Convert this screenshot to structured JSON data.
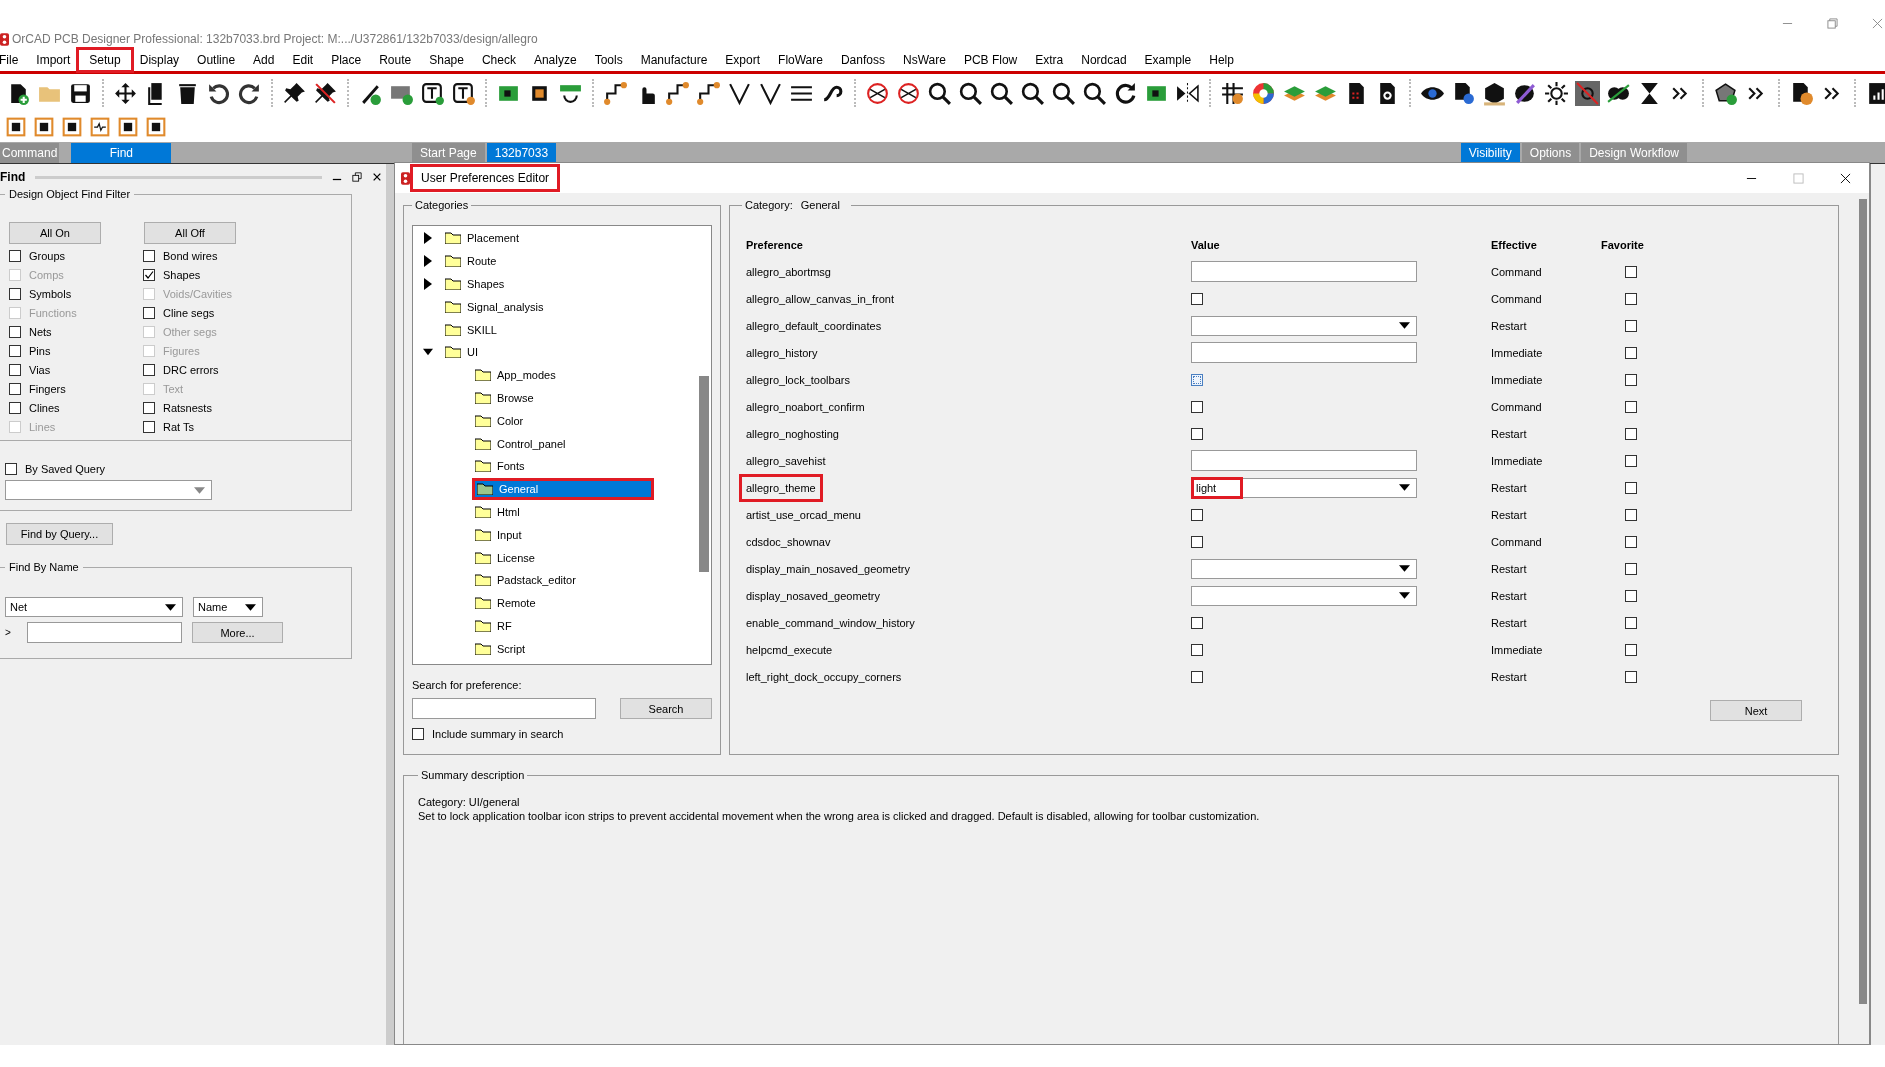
{
  "window": {
    "title": "OrCAD PCB Designer Professional: 132b7033.brd  Project: M:.../U372861/132b7033/design/allegro"
  },
  "menu": [
    {
      "label": "File",
      "highlighted": false
    },
    {
      "label": "Import",
      "highlighted": false
    },
    {
      "label": "Setup",
      "highlighted": true
    },
    {
      "label": "Display",
      "highlighted": false
    },
    {
      "label": "Outline",
      "highlighted": false
    },
    {
      "label": "Add",
      "highlighted": false
    },
    {
      "label": "Edit",
      "highlighted": false
    },
    {
      "label": "Place",
      "highlighted": false
    },
    {
      "label": "Route",
      "highlighted": false
    },
    {
      "label": "Shape",
      "highlighted": false
    },
    {
      "label": "Check",
      "highlighted": false
    },
    {
      "label": "Analyze",
      "highlighted": false
    },
    {
      "label": "Tools",
      "highlighted": false
    },
    {
      "label": "Manufacture",
      "highlighted": false
    },
    {
      "label": "Export",
      "highlighted": false
    },
    {
      "label": "FloWare",
      "highlighted": false
    },
    {
      "label": "Danfoss",
      "highlighted": false
    },
    {
      "label": "NsWare",
      "highlighted": false
    },
    {
      "label": "PCB Flow",
      "highlighted": false
    },
    {
      "label": "Extra",
      "highlighted": false
    },
    {
      "label": "Nordcad",
      "highlighted": false
    },
    {
      "label": "Example",
      "highlighted": false
    },
    {
      "label": "Help",
      "highlighted": false
    }
  ],
  "panel_tabs": [
    {
      "label": "Command",
      "selected": false
    },
    {
      "label": "Find",
      "selected": true
    }
  ],
  "doc_tabs": [
    {
      "label": "Start Page",
      "selected": false
    },
    {
      "label": "132b7033",
      "selected": true
    }
  ],
  "right_tabs": [
    {
      "label": "Visibility",
      "selected": true
    },
    {
      "label": "Options",
      "selected": false
    },
    {
      "label": "Design Workflow",
      "selected": false
    }
  ],
  "find_panel": {
    "title": "Find",
    "filter_title": "Design Object Find Filter",
    "buttons": [
      "All On",
      "All Off"
    ],
    "filters": [
      {
        "label": "Groups",
        "checked": false,
        "disabled": false
      },
      {
        "label": "Comps",
        "checked": false,
        "disabled": true
      },
      {
        "label": "Symbols",
        "checked": false,
        "disabled": false
      },
      {
        "label": "Functions",
        "checked": false,
        "disabled": true
      },
      {
        "label": "Nets",
        "checked": false,
        "disabled": false
      },
      {
        "label": "Pins",
        "checked": false,
        "disabled": false
      },
      {
        "label": "Vias",
        "checked": false,
        "disabled": false
      },
      {
        "label": "Fingers",
        "checked": false,
        "disabled": false
      },
      {
        "label": "Clines",
        "checked": false,
        "disabled": false
      },
      {
        "label": "Lines",
        "checked": false,
        "disabled": true
      },
      {
        "label": "Bond wires",
        "checked": false,
        "disabled": false
      },
      {
        "label": "Shapes",
        "checked": true,
        "disabled": false
      },
      {
        "label": "Voids/Cavities",
        "checked": false,
        "disabled": true
      },
      {
        "label": "Cline segs",
        "checked": false,
        "disabled": false
      },
      {
        "label": "Other segs",
        "checked": false,
        "disabled": true
      },
      {
        "label": "Figures",
        "checked": false,
        "disabled": true
      },
      {
        "label": "DRC errors",
        "checked": false,
        "disabled": false
      },
      {
        "label": "Text",
        "checked": false,
        "disabled": true
      },
      {
        "label": "Ratsnests",
        "checked": false,
        "disabled": false
      },
      {
        "label": "Rat Ts",
        "checked": false,
        "disabled": false
      }
    ],
    "saved_query": {
      "label": "By Saved Query",
      "checked": false
    },
    "find_by_query": "Find by Query...",
    "find_by_name": {
      "title": "Find By Name",
      "type": "Net",
      "mode": "Name",
      "prompt": ">",
      "more": "More..."
    }
  },
  "dialog": {
    "title": "User Preferences Editor",
    "highlighted": true,
    "categories_title": "Categories",
    "tree": [
      {
        "label": "Placement",
        "expanded": false,
        "selected": false,
        "highlighted": false
      },
      {
        "label": "Route",
        "expanded": false,
        "selected": false,
        "highlighted": false
      },
      {
        "label": "Shapes",
        "expanded": false,
        "selected": false,
        "highlighted": false
      },
      {
        "label": "Signal_analysis",
        "selected": false,
        "highlighted": false
      },
      {
        "label": "SKILL",
        "selected": false,
        "highlighted": false
      },
      {
        "label": "UI",
        "expanded": true,
        "selected": false,
        "highlighted": false,
        "children": [
          {
            "label": "App_modes",
            "selected": false,
            "highlighted": false
          },
          {
            "label": "Browse",
            "selected": false,
            "highlighted": false
          },
          {
            "label": "Color",
            "selected": false,
            "highlighted": false
          },
          {
            "label": "Control_panel",
            "selected": false,
            "highlighted": false
          },
          {
            "label": "Fonts",
            "selected": false,
            "highlighted": false
          },
          {
            "label": "General",
            "selected": true,
            "highlighted": true
          },
          {
            "label": "Html",
            "selected": false,
            "highlighted": false
          },
          {
            "label": "Input",
            "selected": false,
            "highlighted": false
          },
          {
            "label": "License",
            "selected": false,
            "highlighted": false
          },
          {
            "label": "Padstack_editor",
            "selected": false,
            "highlighted": false
          },
          {
            "label": "Remote",
            "selected": false,
            "highlighted": false
          },
          {
            "label": "RF",
            "selected": false,
            "highlighted": false
          },
          {
            "label": "Script",
            "selected": false,
            "highlighted": false
          }
        ]
      }
    ],
    "search_label": "Search for preference:",
    "search_button": "Search",
    "include_summary": {
      "label": "Include summary in search",
      "checked": false
    },
    "category_label": "Category:",
    "category": "General",
    "columns": [
      "Preference",
      "Value",
      "Effective",
      "Favorite"
    ],
    "prefs": [
      {
        "name": "allegro_abortmsg",
        "kind": "text",
        "effective": "Command",
        "favorite": false,
        "highlighted": false
      },
      {
        "name": "allegro_allow_canvas_in_front",
        "kind": "check",
        "checked": false,
        "focused": false,
        "effective": "Command",
        "favorite": false,
        "highlighted": false
      },
      {
        "name": "allegro_default_coordinates",
        "kind": "select",
        "effective": "Restart",
        "favorite": false,
        "highlighted": false
      },
      {
        "name": "allegro_history",
        "kind": "text",
        "effective": "Immediate",
        "favorite": false,
        "highlighted": false
      },
      {
        "name": "allegro_lock_toolbars",
        "kind": "check",
        "checked": false,
        "focused": true,
        "effective": "Immediate",
        "favorite": false,
        "highlighted": false
      },
      {
        "name": "allegro_noabort_confirm",
        "kind": "check",
        "checked": false,
        "focused": false,
        "effective": "Command",
        "favorite": false,
        "highlighted": false
      },
      {
        "name": "allegro_noghosting",
        "kind": "check",
        "checked": false,
        "focused": false,
        "effective": "Restart",
        "favorite": false,
        "highlighted": false
      },
      {
        "name": "allegro_savehist",
        "kind": "text",
        "effective": "Immediate",
        "favorite": false,
        "highlighted": false
      },
      {
        "name": "allegro_theme",
        "kind": "select",
        "value": "light",
        "value_highlighted": true,
        "effective": "Restart",
        "favorite": false,
        "highlighted": true
      },
      {
        "name": "artist_use_orcad_menu",
        "kind": "check",
        "checked": false,
        "focused": false,
        "effective": "Restart",
        "favorite": false,
        "highlighted": false
      },
      {
        "name": "cdsdoc_shownav",
        "kind": "check",
        "checked": false,
        "focused": false,
        "effective": "Command",
        "favorite": false,
        "highlighted": false
      },
      {
        "name": "display_main_nosaved_geometry",
        "kind": "select",
        "effective": "Restart",
        "favorite": false,
        "highlighted": false
      },
      {
        "name": "display_nosaved_geometry",
        "kind": "select",
        "effective": "Restart",
        "favorite": false,
        "highlighted": false
      },
      {
        "name": "enable_command_window_history",
        "kind": "check",
        "checked": false,
        "focused": false,
        "effective": "Restart",
        "favorite": false,
        "highlighted": false
      },
      {
        "name": "helpcmd_execute",
        "kind": "check",
        "checked": false,
        "focused": false,
        "effective": "Immediate",
        "favorite": false,
        "highlighted": false
      },
      {
        "name": "left_right_dock_occupy_corners",
        "kind": "check",
        "checked": false,
        "focused": false,
        "effective": "Restart",
        "favorite": false,
        "highlighted": false
      }
    ],
    "next": "Next",
    "summary_title": "Summary description",
    "summary_category": "Category: UI/general",
    "summary_text": "Set to lock application toolbar icon strips to prevent accidental movement when the wrong area is clicked and dragged. Default is disabled, allowing for toolbar customization."
  }
}
